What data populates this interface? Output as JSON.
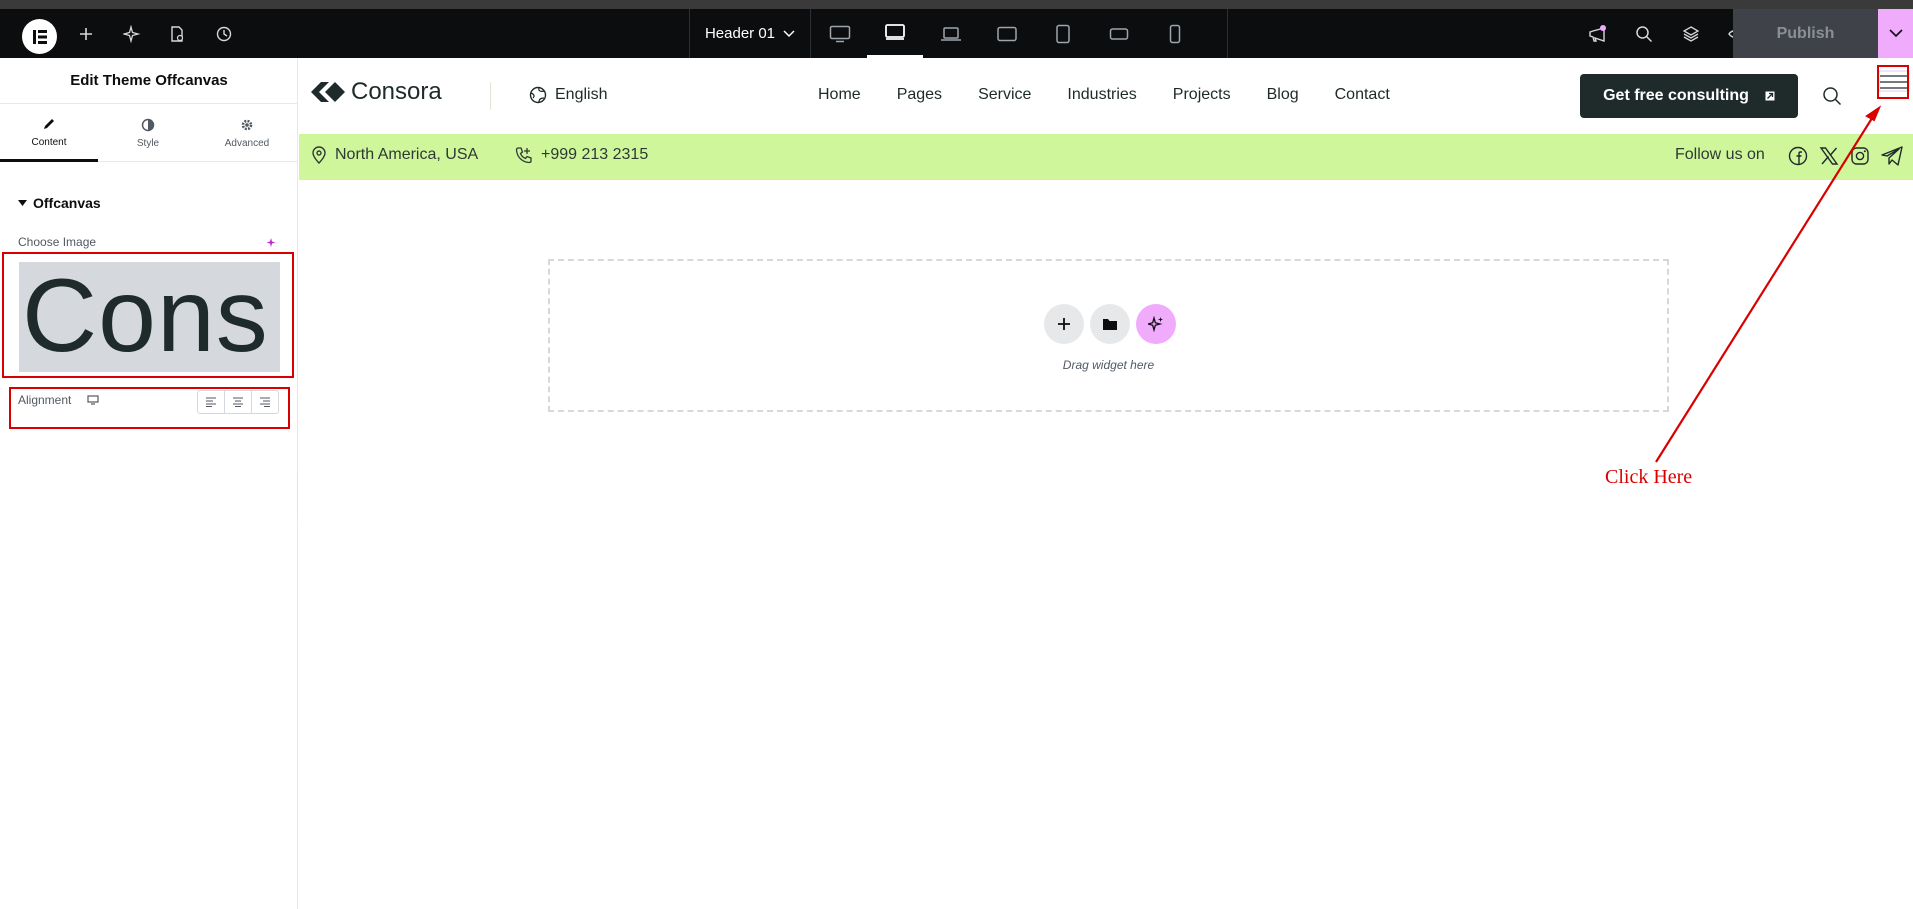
{
  "topbar": {
    "document_title": "Header 01",
    "publish_label": "Publish",
    "icons": [
      "elementor-logo-icon",
      "add-icon",
      "ai-sparkle-icon",
      "page-settings-icon",
      "history-icon",
      "whats-new-icon",
      "search-icon",
      "structure-icon",
      "preview-icon"
    ],
    "devices": [
      "desktop",
      "tablet-landscape",
      "laptop",
      "tablet-extra",
      "tablet",
      "mobile-extra",
      "mobile"
    ],
    "active_device": "tablet-landscape"
  },
  "panel": {
    "title": "Edit Theme Offcanvas",
    "tabs": [
      {
        "label": "Content",
        "icon": "pencil-icon",
        "active": true
      },
      {
        "label": "Style",
        "icon": "half-circle-icon",
        "active": false
      },
      {
        "label": "Advanced",
        "icon": "gear-icon",
        "active": false
      }
    ],
    "section": "Offcanvas",
    "choose_image_label": "Choose Image",
    "image_preview_text": "Cons",
    "alignment_label": "Alignment"
  },
  "site": {
    "brand": "Consora",
    "language": "English",
    "nav": [
      "Home",
      "Pages",
      "Service",
      "Industries",
      "Projects",
      "Blog",
      "Contact"
    ],
    "cta": "Get free consulting",
    "location": "North America, USA",
    "phone": "+999 213 2315",
    "follow": "Follow us on",
    "socials": [
      "facebook-icon",
      "x-icon",
      "instagram-icon",
      "telegram-icon"
    ]
  },
  "dropzone": {
    "text": "Drag widget here"
  },
  "annotation": {
    "text": "Click Here",
    "color": "#d90000"
  },
  "colors": {
    "topbar_bg": "#0c0d0e",
    "accent_pink": "#f0abfc",
    "info_bar": "#cff69b",
    "cta_bg": "#1f2a2a"
  }
}
